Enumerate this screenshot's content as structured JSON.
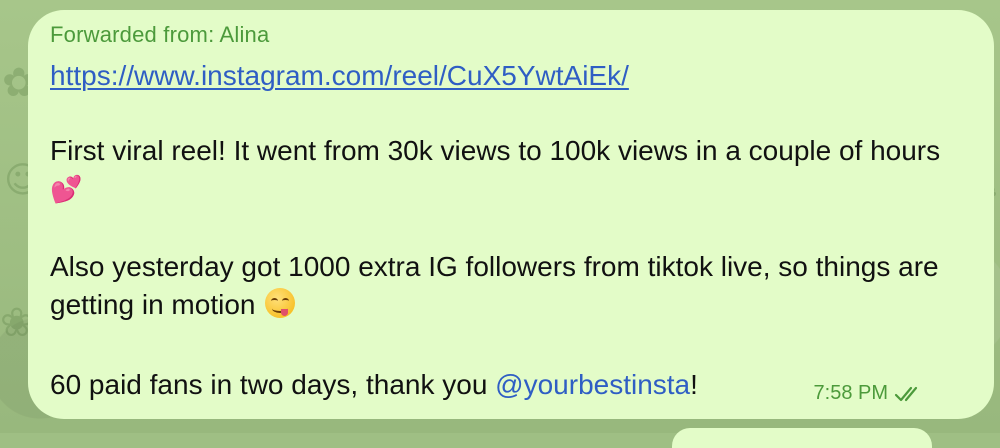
{
  "message": {
    "forwarded_from": "Forwarded from: Alina",
    "link": "https://www.instagram.com/reel/CuX5YwtAiEk/",
    "paragraph1": "First viral reel! It went from 30k views to 100k views in a couple of hours",
    "paragraph2": "Also yesterday got 1000 extra IG followers from tiktok live, so things are getting in motion",
    "paragraph3_before": "60 paid fans in two days, thank you ",
    "mention": "@yourbestinsta",
    "paragraph3_after": "!",
    "time": "7:58 PM",
    "emoji1": "💕"
  },
  "colors": {
    "bubble": "#e3fcc8",
    "accent_green": "#4c9a3b",
    "link_blue": "#2f5ec4",
    "text": "#111111",
    "wallpaper": "#9fbf84"
  },
  "icons": {
    "read_status": "double-check-icon",
    "heart": "two-hearts-emoji",
    "smile": "face-savoring-food-emoji"
  }
}
